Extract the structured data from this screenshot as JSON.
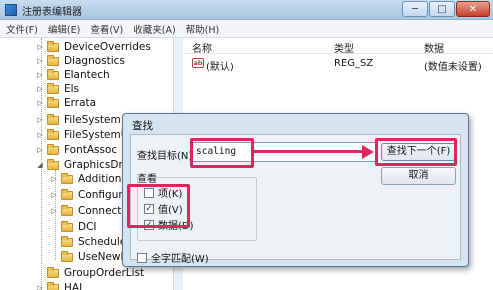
{
  "window": {
    "title": "注册表编辑器",
    "controls": {
      "minimize": "─",
      "maximize": "□",
      "close": "✕"
    }
  },
  "menu": [
    "文件(F)",
    "编辑(E)",
    "查看(V)",
    "收藏夹(A)",
    "帮助(H)"
  ],
  "tree": {
    "items": [
      {
        "label": "DeviceOverrides",
        "expandable": true
      },
      {
        "label": "Diagnostics",
        "expandable": true
      },
      {
        "label": "Elantech",
        "expandable": true
      },
      {
        "label": "Els",
        "expandable": true
      },
      {
        "label": "Errata",
        "expandable": true
      },
      {
        "label": "FileSystem",
        "expandable": true
      },
      {
        "label": "FileSystemUti",
        "expandable": true
      },
      {
        "label": "FontAssoc",
        "expandable": true
      },
      {
        "label": "GraphicsDrive",
        "expandable": true,
        "expanded": true
      },
      {
        "label": "Additional",
        "expandable": true
      },
      {
        "label": "Configura",
        "expandable": true
      },
      {
        "label": "Connectivi",
        "expandable": true
      },
      {
        "label": "DCI",
        "expandable": false
      },
      {
        "label": "Scheduler",
        "expandable": false
      },
      {
        "label": "UseNewKe",
        "expandable": false
      },
      {
        "label": "GroupOrderList",
        "expandable": false
      },
      {
        "label": "HAL",
        "expandable": true
      }
    ]
  },
  "list": {
    "columns": {
      "name": "名称",
      "type": "类型",
      "data": "数据"
    },
    "rows": [
      {
        "icon": "ab",
        "name": "(默认)",
        "type": "REG_SZ",
        "data": "(数值未设置)"
      }
    ]
  },
  "find_dialog": {
    "title": "查找",
    "target_label": "查找目标(N):",
    "target_value": "scaling",
    "find_next_label": "查找下一个(F)",
    "cancel_label": "取消",
    "look_at_label": "查看",
    "options": [
      {
        "label": "项(K)",
        "checked": false
      },
      {
        "label": "值(V)",
        "checked": true
      },
      {
        "label": "数据(D)",
        "checked": true
      }
    ],
    "match_whole_label": "全字匹配(W)",
    "match_whole_checked": false
  },
  "annotation": {
    "highlight_color": "#e0245e"
  }
}
